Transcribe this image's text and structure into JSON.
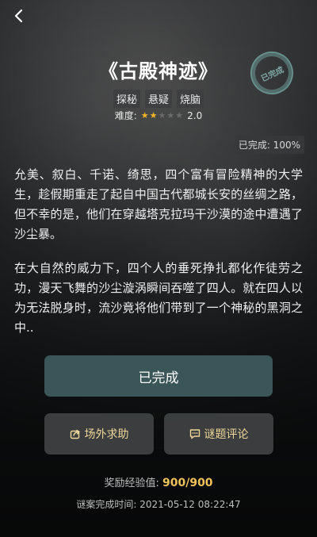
{
  "header": {
    "back_icon": "chevron-left-icon"
  },
  "case": {
    "title": "《古殿神迹》",
    "stamp": "已完成",
    "tags": [
      "探秘",
      "悬疑",
      "烧脑"
    ],
    "difficulty_label": "难度:",
    "difficulty_rating": 2,
    "difficulty_max": 5,
    "difficulty_value": "2.0",
    "progress_label": "已完成: 100%"
  },
  "story": {
    "paragraphs": [
      "允美、叙白、千诺、绮思，四个富有冒险精神的大学生，趁假期重走了起自中国古代都城长安的丝绸之路，但不幸的是，他们在穿越塔克拉玛干沙漠的途中遭遇了沙尘暴。",
      "在大自然的威力下，四个人的垂死挣扎都化作徒劳之功，漫天飞舞的沙尘漩涡瞬间吞噬了四人。就在四人以为无法脱身时，流沙竟将他们带到了一个神秘的黑洞之中.."
    ]
  },
  "actions": {
    "main_label": "已完成",
    "help_label": "场外求助",
    "help_icon": "share-icon",
    "comment_label": "谜题评论",
    "comment_icon": "comment-icon"
  },
  "footer": {
    "reward_label": "奖励经验值:",
    "reward_value": "900/900",
    "finish_time": "谜案完成时间:  2021-05-12 08:22:47"
  },
  "colors": {
    "accent_button": "#3b5658",
    "gold": "#f0c35a",
    "star_on": "#f0b428"
  }
}
